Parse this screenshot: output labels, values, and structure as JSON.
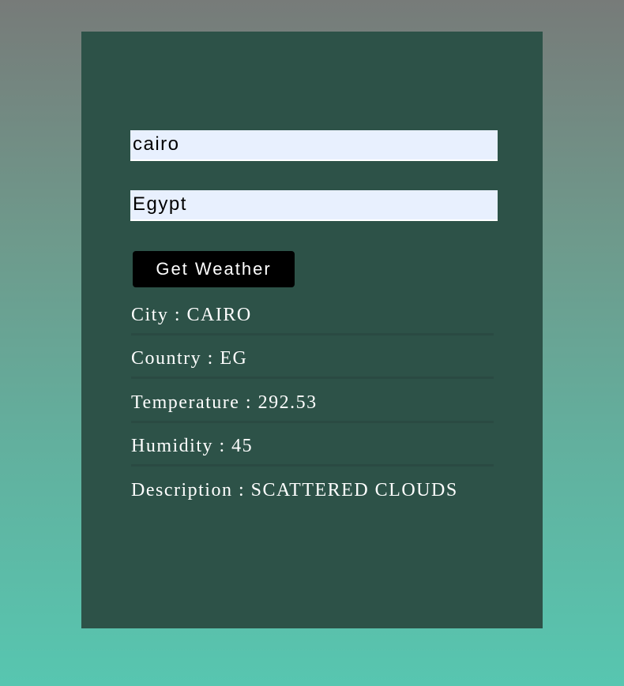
{
  "form": {
    "city_value": "cairo",
    "country_value": "Egypt",
    "submit_label": "Get Weather"
  },
  "results": {
    "city": "City : CAIRO",
    "country": "Country : EG",
    "temperature": "Temperature : 292.53",
    "humidity": "Humidity : 45",
    "description": "Description : SCATTERED CLOUDS"
  },
  "colors": {
    "card_background": "#2d5248",
    "input_background": "#e8f0fe",
    "button_background": "#000000",
    "text_color": "#ffffff",
    "page_gradient_top": "#777b79",
    "page_gradient_bottom": "#57c6b0"
  }
}
